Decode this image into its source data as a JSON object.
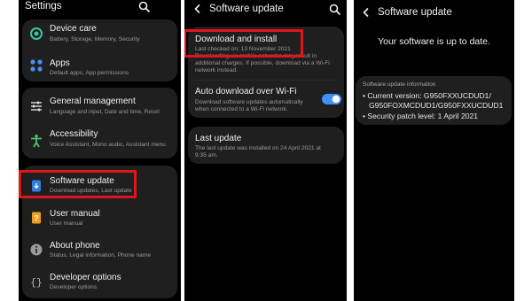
{
  "colors": {
    "panel_bg": "#000000",
    "card_bg": "#1f1f1f",
    "highlight_border": "#e2141a",
    "toggle_on": "#3e91ff"
  },
  "panel1": {
    "title": "Settings",
    "search_icon": "search-icon",
    "items": [
      {
        "icon": "device-care-icon",
        "label": "Device care",
        "subtitle": "Battery, Storage, Memory, Security"
      },
      {
        "icon": "apps-icon",
        "label": "Apps",
        "subtitle": "Default apps, App permissions"
      },
      {
        "icon": "general-management-icon",
        "label": "General management",
        "subtitle": "Language and input, Date and time, Reset"
      },
      {
        "icon": "accessibility-icon",
        "label": "Accessibility",
        "subtitle": "Voice Assistant, Mono audio, Assistant menu"
      },
      {
        "icon": "software-update-icon",
        "label": "Software update",
        "subtitle": "Download updates, Last update"
      },
      {
        "icon": "user-manual-icon",
        "label": "User manual",
        "subtitle": "User manual"
      },
      {
        "icon": "about-phone-icon",
        "label": "About phone",
        "subtitle": "Status, Legal information, Phone name"
      },
      {
        "icon": "developer-options-icon",
        "label": "Developer options",
        "subtitle": "Developer options"
      }
    ]
  },
  "panel2": {
    "back_icon": "back-icon",
    "title": "Software update",
    "search_icon": "search-icon",
    "download": {
      "label": "Download and install",
      "last_checked": "Last checked on: 13 November 2021",
      "note_line1": "Downloading via mobile networks may result in",
      "note_line2": "additional charges. If possible, download via a Wi-Fi",
      "note_line3": "network instead."
    },
    "auto": {
      "label": "Auto download over Wi-Fi",
      "line1": "Download software updates automatically",
      "line2": "when connected to a Wi-Fi network.",
      "toggle_on": true
    },
    "last": {
      "label": "Last update",
      "line1": "The last update was installed on 24 April 2021 at",
      "line2": "9:35 am."
    }
  },
  "panel3": {
    "back_icon": "back-icon",
    "title": "Software update",
    "message": "Your software is up to date.",
    "info": {
      "heading": "Software update information",
      "line1": "• Current version: G950FXXUCDUD1/",
      "line2": "G950FOXMCDUD1/G950FXXUCDUD1",
      "line3": "• Security patch level: 1 April 2021"
    }
  }
}
